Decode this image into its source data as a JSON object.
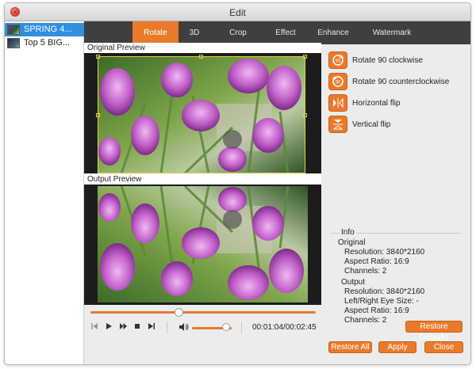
{
  "window": {
    "title": "Edit",
    "close_glyph": "×"
  },
  "sidebar": {
    "items": [
      {
        "label": "SPRING 4...",
        "selected": true
      },
      {
        "label": "Top 5 BIG...",
        "selected": false
      }
    ]
  },
  "tabs": [
    {
      "label": "Rotate",
      "active": true
    },
    {
      "label": "3D",
      "active": false
    },
    {
      "label": "Crop",
      "active": false
    },
    {
      "label": "Effect",
      "active": false
    },
    {
      "label": "Enhance",
      "active": false
    },
    {
      "label": "Watermark",
      "active": false
    }
  ],
  "previews": {
    "original_label": "Original Preview",
    "output_label": "Output Preview"
  },
  "player": {
    "time": "00:01:04/00:02:45",
    "progress": 0.39,
    "volume": 0.85
  },
  "actions": [
    {
      "label": "Rotate 90 clockwise",
      "icon": "rotate-clockwise-icon"
    },
    {
      "label": "Rotate 90 counterclockwise",
      "icon": "rotate-counterclockwise-icon"
    },
    {
      "label": "Horizontal flip",
      "icon": "horizontal-flip-icon"
    },
    {
      "label": "Vertical flip",
      "icon": "vertical-flip-icon"
    }
  ],
  "info": {
    "title": "Info",
    "original_heading": "Original",
    "original": {
      "resolution": "Resolution: 3840*2160",
      "aspect": "Aspect Ratio: 16:9",
      "channels": "Channels: 2"
    },
    "output_heading": "Output",
    "output": {
      "resolution": "Resolution: 3840*2160",
      "eye_size": "Left/Right Eye Size: -",
      "aspect": "Aspect Ratio: 16:9",
      "channels": "Channels: 2"
    }
  },
  "buttons": {
    "restore_defaults": "Restore Defaults",
    "restore_all": "Restore All",
    "apply": "Apply",
    "close": "Close"
  },
  "colors": {
    "accent": "#e97a2c",
    "selection": "#2f8fe0",
    "tabbar": "#3f3f3f"
  }
}
